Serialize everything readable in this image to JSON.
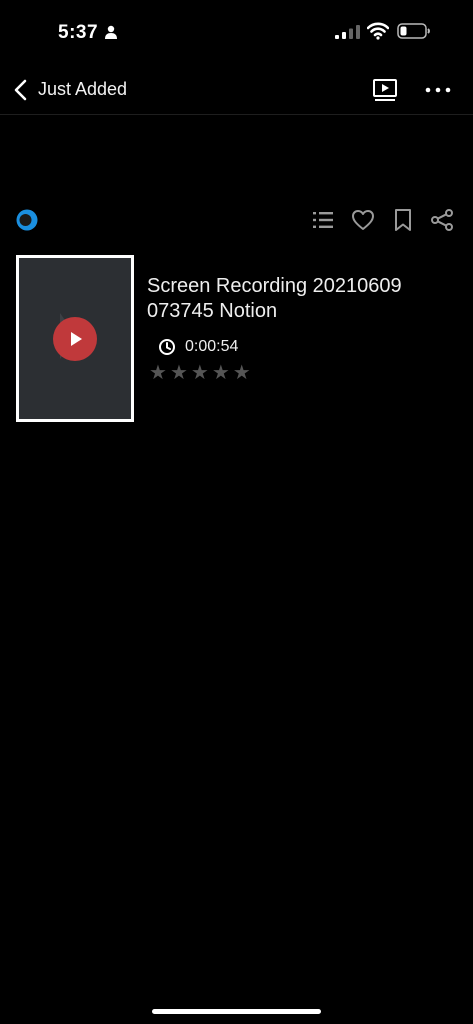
{
  "status_bar": {
    "time": "5:37"
  },
  "nav": {
    "back_label": "Just Added"
  },
  "item": {
    "title": "Screen Recording 20210609 073745 Notion",
    "duration": "0:00:54",
    "rating": 0,
    "rating_max": 5
  },
  "colors": {
    "background": "#000000",
    "play_button": "#c0393b",
    "logo_accent": "#1a8fe0"
  }
}
